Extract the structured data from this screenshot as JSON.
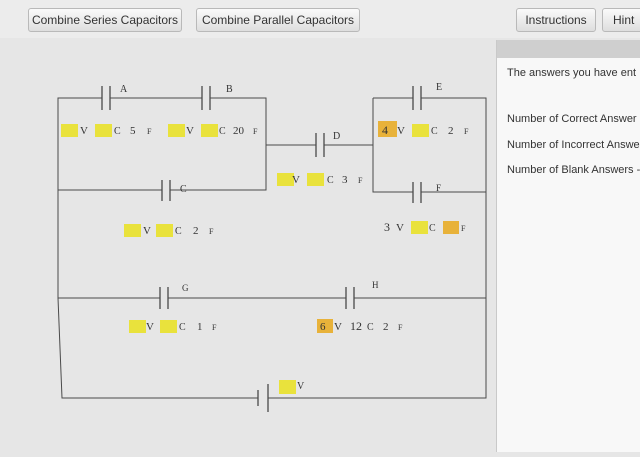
{
  "toolbar": {
    "combine_series": "Combine Series Capacitors",
    "combine_parallel": "Combine Parallel Capacitors",
    "instructions": "Instructions",
    "hint": "Hint"
  },
  "results": {
    "intro": "The answers you have ent",
    "correct": "Number of Correct Answer",
    "incorrect": "Number of Incorrect Answe",
    "blank": "Number of Blank Answers -"
  },
  "circuit": {
    "cap_A": {
      "label": "A",
      "voltage": "",
      "v_unit": "V",
      "c_prefix": "C",
      "capacitance": "5",
      "unit": "F"
    },
    "cap_B": {
      "label": "B",
      "voltage": "",
      "v_unit": "V",
      "c_prefix": "C",
      "capacitance": "20",
      "unit": "F"
    },
    "cap_C": {
      "label": "C",
      "voltage": "",
      "v_unit": "V",
      "c_prefix": "C",
      "capacitance": "2",
      "unit": "F"
    },
    "cap_D": {
      "label": "D",
      "voltage": "",
      "v_unit": "V",
      "c_prefix": "C",
      "capacitance": "3",
      "unit": "F"
    },
    "cap_E": {
      "label": "E",
      "voltage": "4",
      "v_unit": "V",
      "c_prefix": "C",
      "capacitance": "2",
      "unit": "F"
    },
    "cap_F": {
      "label": "F",
      "voltage": "3",
      "v_unit": "V",
      "c_prefix": "C",
      "capacitance": "",
      "unit": "F"
    },
    "cap_G": {
      "label": "G",
      "voltage": "",
      "v_unit": "V",
      "c_prefix": "C",
      "capacitance": "1",
      "unit": "F"
    },
    "cap_H": {
      "label": "H",
      "voltage": "6",
      "v_unit": "V",
      "c_prefix": "C",
      "capacitance": "2",
      "unit": "F",
      "charge_value": "12"
    },
    "battery": {
      "voltage": "",
      "v_unit": "V"
    }
  },
  "colors": {
    "highlight": "#e9e23c",
    "highlight_filled": "#e8b23a",
    "wire": "#4a4a4a"
  }
}
